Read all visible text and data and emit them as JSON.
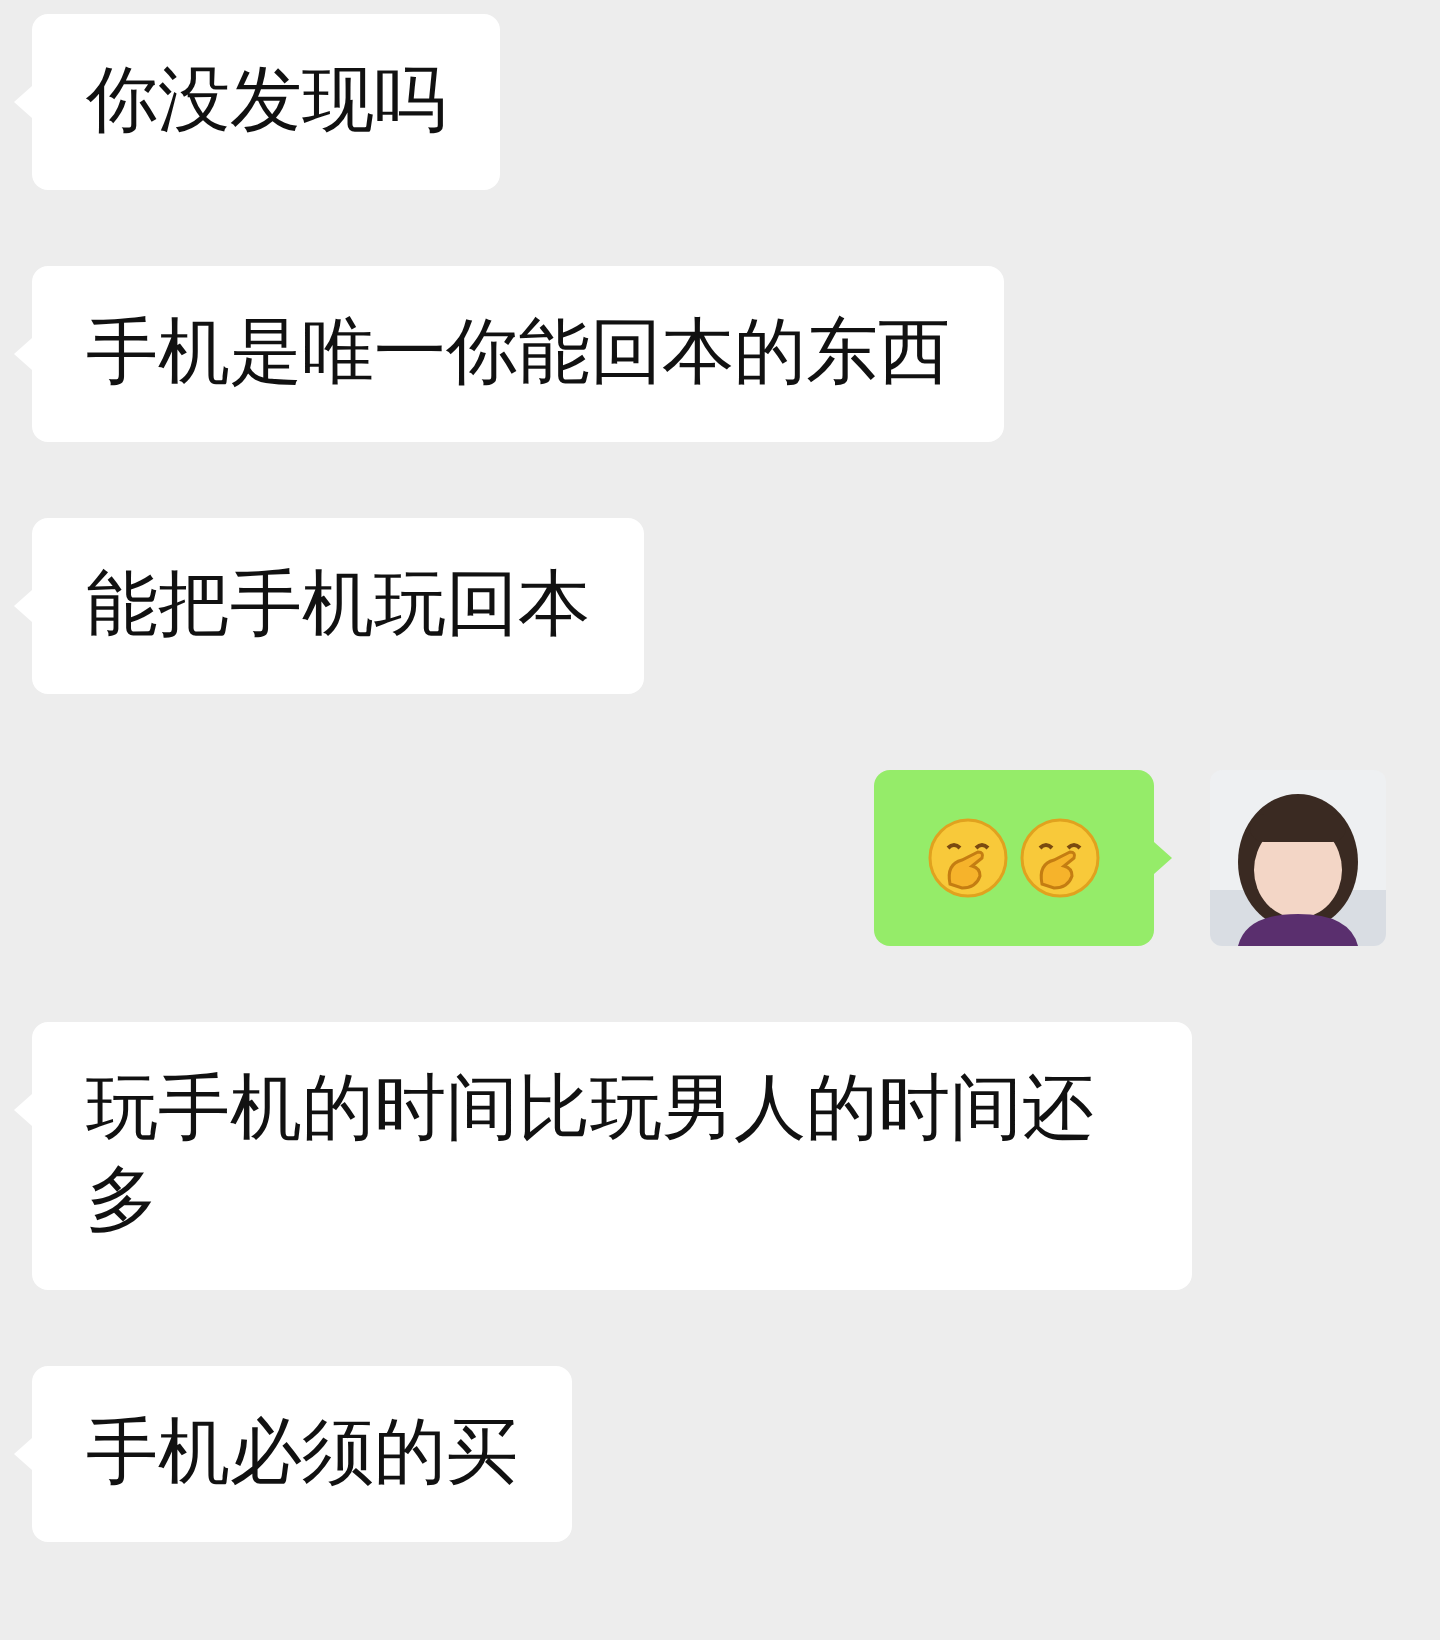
{
  "messages": [
    {
      "outgoing": false,
      "kind": "text",
      "text": "你没发现吗"
    },
    {
      "outgoing": false,
      "kind": "text",
      "text": "手机是唯一你能回本的东西"
    },
    {
      "outgoing": false,
      "kind": "text",
      "text": "能把手机玩回本"
    },
    {
      "outgoing": true,
      "kind": "emoji",
      "emojis": [
        {
          "kind": "hand-over-mouth"
        },
        {
          "kind": "hand-over-mouth"
        }
      ]
    },
    {
      "outgoing": false,
      "kind": "text",
      "text": "玩手机的时间比玩男人的时间还多"
    },
    {
      "outgoing": false,
      "kind": "text",
      "text": "手机必须的买"
    }
  ]
}
